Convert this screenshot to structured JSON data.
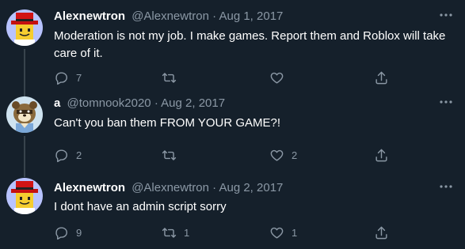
{
  "tweets": [
    {
      "display_name": "Alexnewtron",
      "handle": "@Alexnewtron",
      "separator": "·",
      "date": "Aug 1, 2017",
      "text": "Moderation is not my job. I make games. Report them and Roblox will take care of it.",
      "reply_count": "7",
      "retweet_count": "",
      "like_count": "",
      "avatar": "roblox-red-hat-avatar"
    },
    {
      "display_name": "a",
      "handle": "@tomnook2020",
      "separator": "·",
      "date": "Aug 2, 2017",
      "text": "Can't you ban them FROM YOUR GAME?!",
      "reply_count": "2",
      "retweet_count": "",
      "like_count": "2",
      "avatar": "tom-nook-avatar"
    },
    {
      "display_name": "Alexnewtron",
      "handle": "@Alexnewtron",
      "separator": "·",
      "date": "Aug 2, 2017",
      "text": "I dont have an admin script sorry",
      "reply_count": "9",
      "retweet_count": "1",
      "like_count": "1",
      "avatar": "roblox-red-hat-avatar"
    }
  ],
  "colors": {
    "background": "#15202b",
    "text": "#ffffff",
    "secondary": "#8b98a5",
    "thread_line": "#38444d"
  },
  "icons": [
    "reply-icon",
    "retweet-icon",
    "like-icon",
    "share-icon",
    "more-icon"
  ]
}
